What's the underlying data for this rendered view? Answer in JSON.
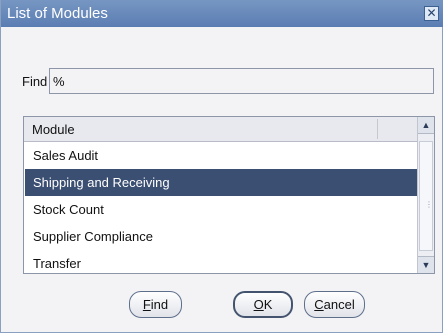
{
  "dialog": {
    "title": "List of Modules",
    "close_glyph": "✕"
  },
  "find": {
    "label": "Find",
    "value": "%"
  },
  "list": {
    "header": "Module",
    "items": [
      "Sales Audit",
      "Shipping and Receiving",
      "Stock Count",
      "Supplier Compliance",
      "Transfer"
    ],
    "selected_index": 1
  },
  "buttons": {
    "find": {
      "mnemonic": "F",
      "rest": "ind"
    },
    "ok": {
      "mnemonic": "O",
      "rest": "K"
    },
    "cancel": {
      "mnemonic": "C",
      "rest": "ancel"
    }
  }
}
